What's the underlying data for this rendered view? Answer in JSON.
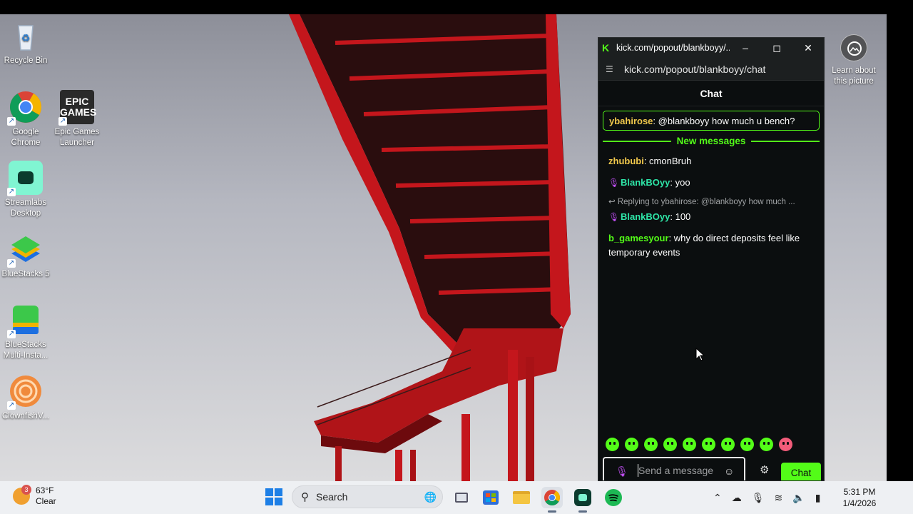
{
  "desktop": {
    "icons": [
      {
        "label": "Recycle Bin",
        "icon": "recycle-bin-icon"
      },
      {
        "label": "Google\nChrome",
        "icon": "chrome-icon"
      },
      {
        "label": "Epic Games\nLauncher",
        "icon": "epic-games-icon"
      },
      {
        "label": "Streamlabs\nDesktop",
        "icon": "streamlabs-icon"
      },
      {
        "label": "BlueStacks 5",
        "icon": "bluestacks-icon"
      },
      {
        "label": "BlueStacks\nMulti-Insta...",
        "icon": "bluestacks-multi-icon"
      },
      {
        "label": "ClownfishV...",
        "icon": "clownfish-icon"
      }
    ],
    "epic_logo_text": "EPIC\nGAMES",
    "learn_about": "Learn about\nthis picture"
  },
  "chat_window": {
    "title": "kick.com/popout/blankboyy/...",
    "url": "kick.com/popout/blankboyy/chat",
    "header": "Chat",
    "pinned": {
      "user": "ybahirose",
      "text": ": @blankboyy how much u bench?"
    },
    "divider": "New messages",
    "messages": [
      {
        "user": "zhububi",
        "text": ": cmonBruh"
      },
      {
        "user": "BlankBOyy",
        "text": ": yoo"
      },
      {
        "reply": "Replying to ybahirose: @blankboyy how much ...",
        "user": "BlankBOyy",
        "text": ": 100"
      },
      {
        "user": "b_gamesyour",
        "text": ": why do direct deposits feel like temporary events"
      }
    ],
    "input_placeholder": "Send a message",
    "send_label": "Chat",
    "accent": "#53fc18"
  },
  "taskbar": {
    "weather_temp": "63°F",
    "weather_cond": "Clear",
    "weather_badge": "3",
    "search_label": "Search",
    "time": "5:31 PM",
    "date": "1/4/2026"
  }
}
